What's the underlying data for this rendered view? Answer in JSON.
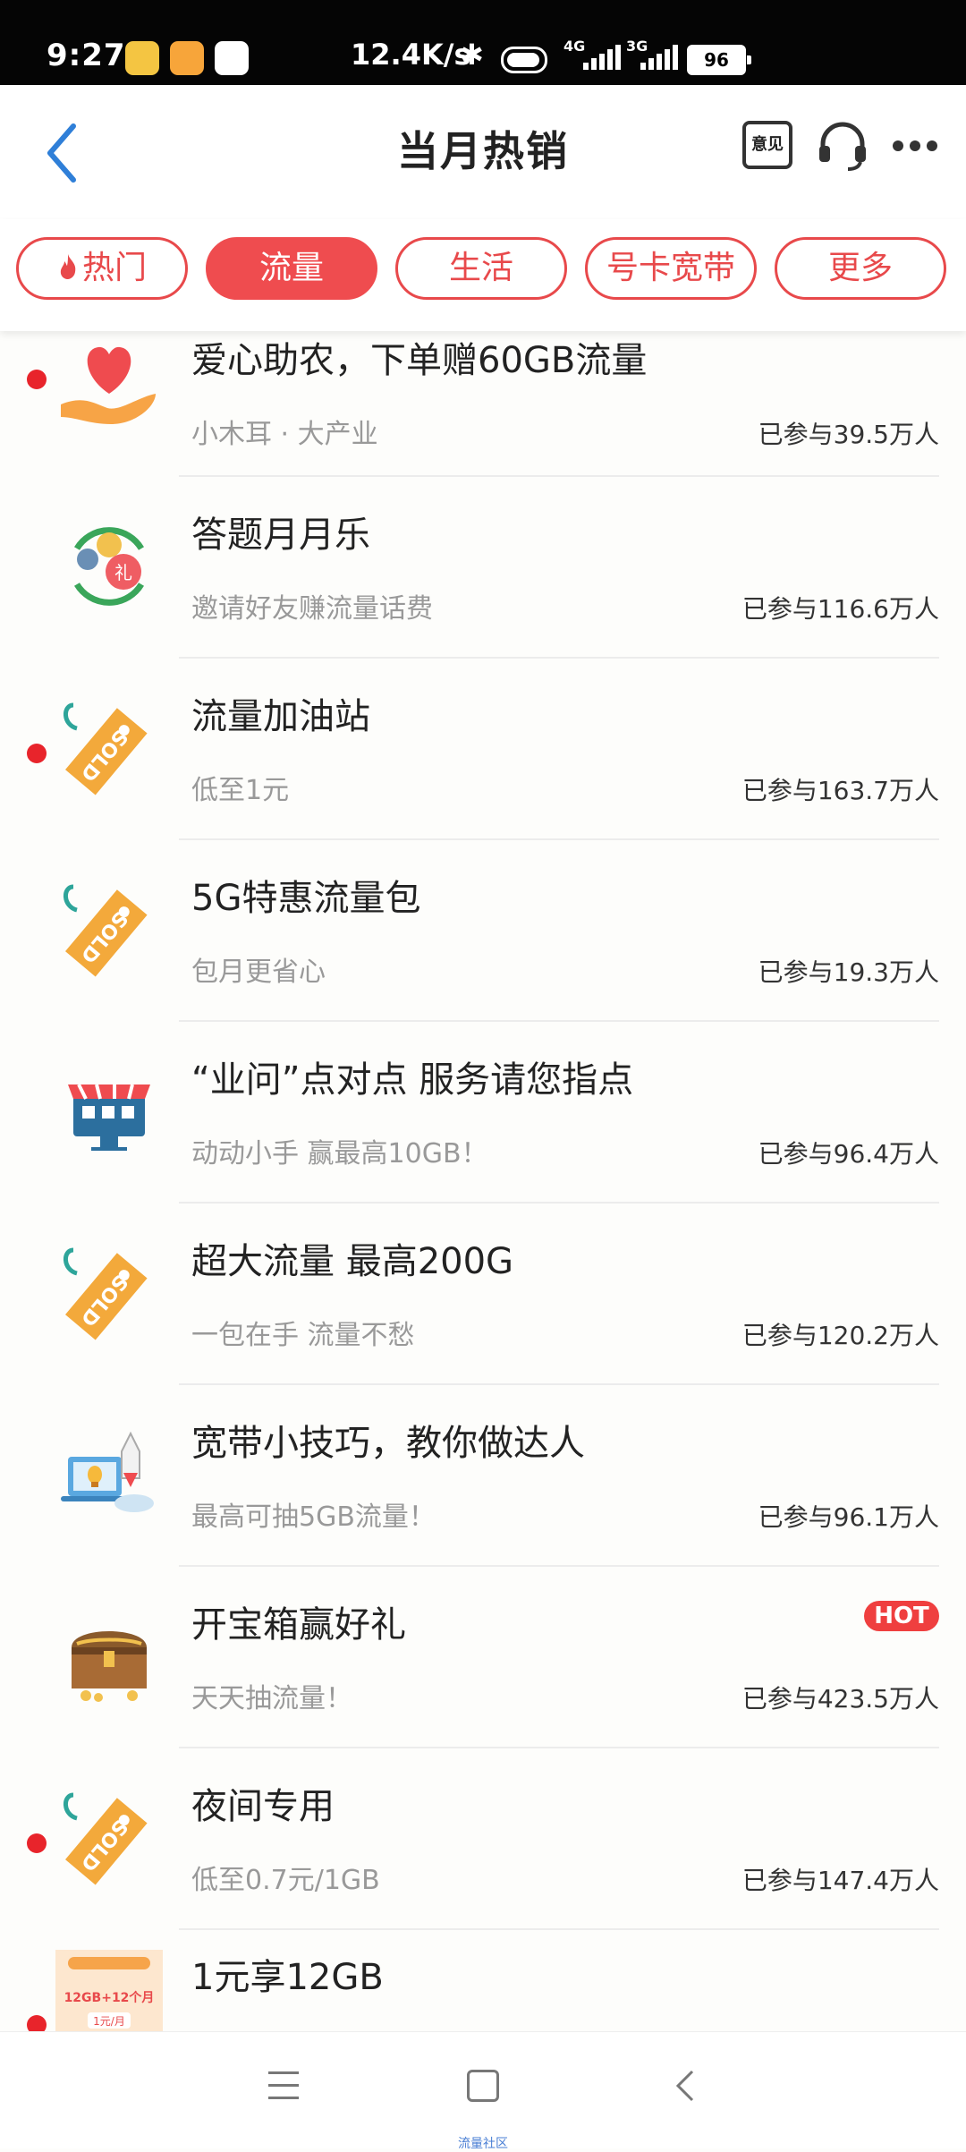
{
  "status_bar": {
    "time": "9:27",
    "net_speed": "12.4K/s",
    "signal1": "4G",
    "signal2": "3G",
    "battery": "96"
  },
  "header": {
    "title": "当月热销",
    "feedback_label": "意见"
  },
  "tabs": [
    {
      "label": "热门",
      "icon": "flame-icon"
    },
    {
      "label": "流量",
      "active": true
    },
    {
      "label": "生活"
    },
    {
      "label": "号卡宽带"
    },
    {
      "label": "更多"
    }
  ],
  "items": [
    {
      "title": "爱心助农，下单赠60GB流量",
      "sub": "小木耳 · 大产业",
      "count": "已参与39.5万人",
      "dot": true,
      "icon": "heart-hand-icon"
    },
    {
      "title": "答题月月乐",
      "sub": "邀请好友赚流量话费",
      "count": "已参与116.6万人",
      "dot": false,
      "icon": "gift-cycle-icon"
    },
    {
      "title": "流量加油站",
      "sub": "低至1元",
      "count": "已参与163.7万人",
      "dot": true,
      "icon": "sold-tag-icon"
    },
    {
      "title": "5G特惠流量包",
      "sub": "包月更省心",
      "count": "已参与19.3万人",
      "dot": false,
      "icon": "sold-tag-icon"
    },
    {
      "title": "“业问”点对点 服务请您指点",
      "sub": "动动小手 赢最高10GB！",
      "count": "已参与96.4万人",
      "dot": false,
      "icon": "shop-icon"
    },
    {
      "title": "超大流量 最高200G",
      "sub": "一包在手 流量不愁",
      "count": "已参与120.2万人",
      "dot": false,
      "icon": "sold-tag-icon"
    },
    {
      "title": "宽带小技巧，教你做达人",
      "sub": "最高可抽5GB流量！",
      "count": "已参与96.1万人",
      "dot": false,
      "icon": "laptop-rocket-icon"
    },
    {
      "title": "开宝箱赢好礼",
      "sub": "天天抽流量！",
      "count": "已参与423.5万人",
      "dot": false,
      "icon": "treasure-chest-icon",
      "badge": "HOT"
    },
    {
      "title": "夜间专用",
      "sub": "低至0.7元/1GB",
      "count": "已参与147.4万人",
      "dot": true,
      "icon": "sold-tag-icon"
    },
    {
      "title": "1元享12GB",
      "sub": "",
      "count": "",
      "dot": true,
      "icon": "promo-card-icon",
      "thumb_text": [
        "12GB+12个月",
        "1元/月"
      ]
    }
  ],
  "navbar": {
    "caption": "流量社区"
  }
}
